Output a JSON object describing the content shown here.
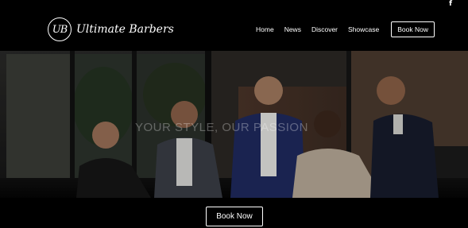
{
  "topbar": {
    "social_icon": "facebook-icon",
    "social_glyph": "f"
  },
  "brand": {
    "monogram": "UB",
    "name": "Ultimate Barbers"
  },
  "nav": {
    "items": [
      {
        "label": "Home"
      },
      {
        "label": "News"
      },
      {
        "label": "Discover"
      },
      {
        "label": "Showcase"
      }
    ],
    "book_label": "Book Now"
  },
  "hero": {
    "tagline": "YOUR STYLE, OUR PASSION"
  },
  "cta": {
    "label": "Book Now"
  },
  "colors": {
    "background": "#000000",
    "text": "#ffffff"
  }
}
